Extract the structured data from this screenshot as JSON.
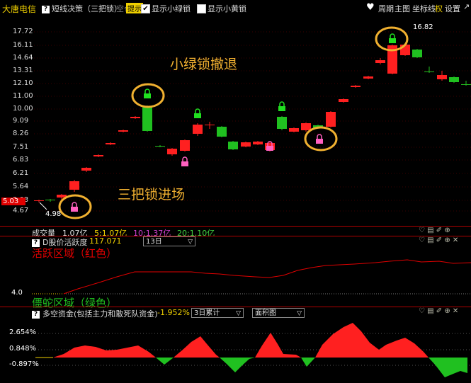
{
  "topbar": {
    "stock_name": "大唐电信",
    "indicator_title": "短线决策（三把锁）",
    "status_empty": "空仓",
    "tip_label": "提示",
    "show_green_lock": "显示小绿锁",
    "show_yellow_lock": "显示小黄锁",
    "period": "周期",
    "main_chart": "主图",
    "axis": "坐标线",
    "right": "权",
    "settings": "设置"
  },
  "main_chart": {
    "price_ticks": [
      "17.72",
      "16.11",
      "14.64",
      "13.31",
      "12.10",
      "11.00",
      "10.00",
      "9.09",
      "8.26",
      "7.51",
      "6.83",
      "6.21",
      "5.64",
      "5.03",
      "4.67"
    ],
    "current_price_label": "5.03",
    "low_label": "4.98",
    "high_label": "16.82",
    "annotation_retreat": "小绿锁撤退",
    "annotation_entry": "三把锁进场"
  },
  "volume_bar": {
    "label": "成交量",
    "value": "1.07亿",
    "ma5": "5:1.07亿",
    "ma10": "10:1.37亿",
    "ma20": "20:1.10亿"
  },
  "activity_panel": {
    "title": "D股价活跃度",
    "value": "117.071",
    "period_select": "13日",
    "active_zone": "活跃区域（红色）",
    "dormant_zone": "僵蛇区域（绿色）",
    "level": "4.0"
  },
  "funds_panel": {
    "title": "多空资金(包括主力和敢死队资金)",
    "value": "-1.952%",
    "period_select": "3日累计",
    "chart_select": "面积图",
    "ticks": [
      "2.654%",
      "0.848%",
      "-0.897%"
    ]
  },
  "colors": {
    "up": "#ff2020",
    "down": "#20c020",
    "annotation": "#f0b030",
    "grid": "#b00000"
  }
}
